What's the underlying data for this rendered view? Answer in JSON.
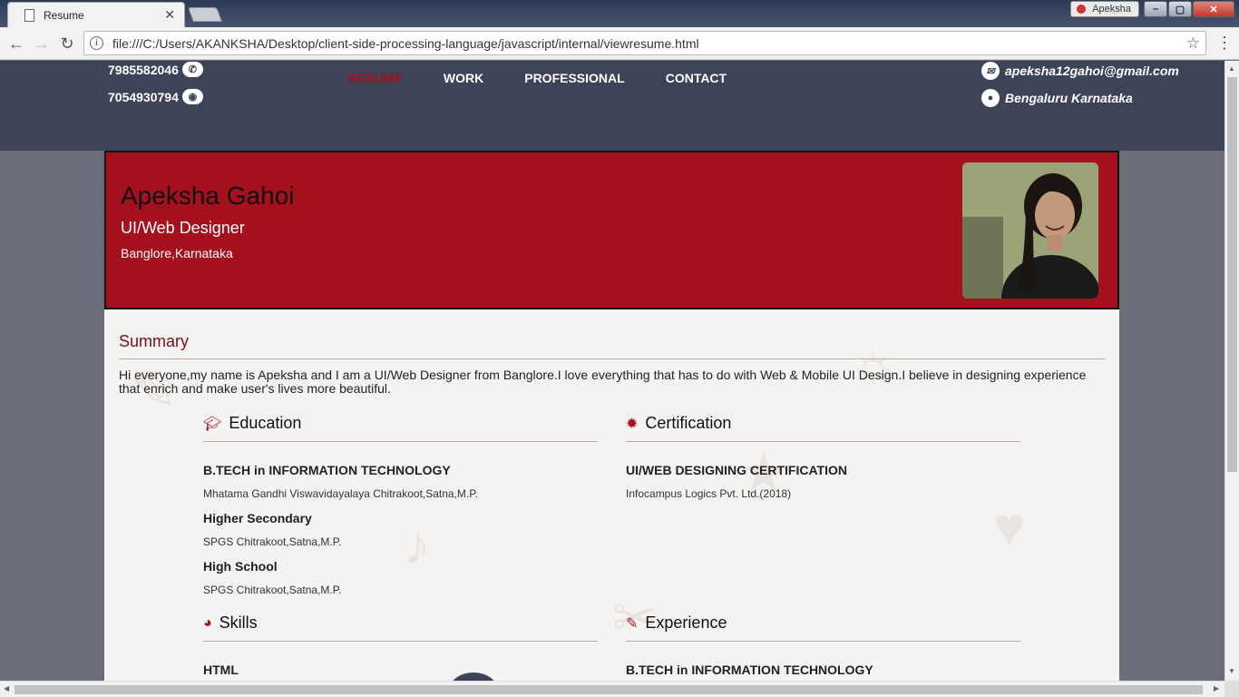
{
  "browser": {
    "tab_title": "Resume",
    "profile_name": "Apeksha",
    "url": "file:///C:/Users/AKANKSHA/Desktop/client-side-processing-language/javascript/internal/viewresume.html"
  },
  "header": {
    "phone": "7985582046",
    "whatsapp": "7054930794",
    "email": "apeksha12gahoi@gmail.com",
    "location": "Bengaluru Karnataka",
    "nav": [
      "RESUME",
      "WORK",
      "PROFESSIONAL",
      "CONTACT"
    ]
  },
  "banner": {
    "name": "Apeksha Gahoi",
    "role": "UI/Web Designer",
    "location": "Banglore,Karnataka"
  },
  "summary": {
    "heading": "Summary",
    "text": "Hi everyone,my name is Apeksha and I am a UI/Web Designer from Banglore.I love everything that has to do with Web & Mobile UI Design.I believe in designing experience that enrich and make user's lives more beautiful."
  },
  "education": {
    "heading": "Education",
    "items": [
      {
        "title": "B.TECH in INFORMATION TECHNOLOGY",
        "sub": "Mhatama Gandhi Viswavidayalaya Chitrakoot,Satna,M.P."
      },
      {
        "title": "Higher Secondary",
        "sub": "SPGS Chitrakoot,Satna,M.P."
      },
      {
        "title": "High School",
        "sub": "SPGS Chitrakoot,Satna,M.P."
      }
    ]
  },
  "certification": {
    "heading": "Certification",
    "items": [
      {
        "title": "UI/WEB DESIGNING CERTIFICATION",
        "sub": "Infocampus Logics Pvt. Ltd.(2018)"
      }
    ]
  },
  "skills": {
    "heading": "Skills",
    "items": [
      "HTML"
    ]
  },
  "experience": {
    "heading": "Experience",
    "items": [
      "B.TECH in INFORMATION TECHNOLOGY"
    ]
  },
  "colors": {
    "accent": "#a5101d",
    "header_bg": "#3e4458"
  }
}
